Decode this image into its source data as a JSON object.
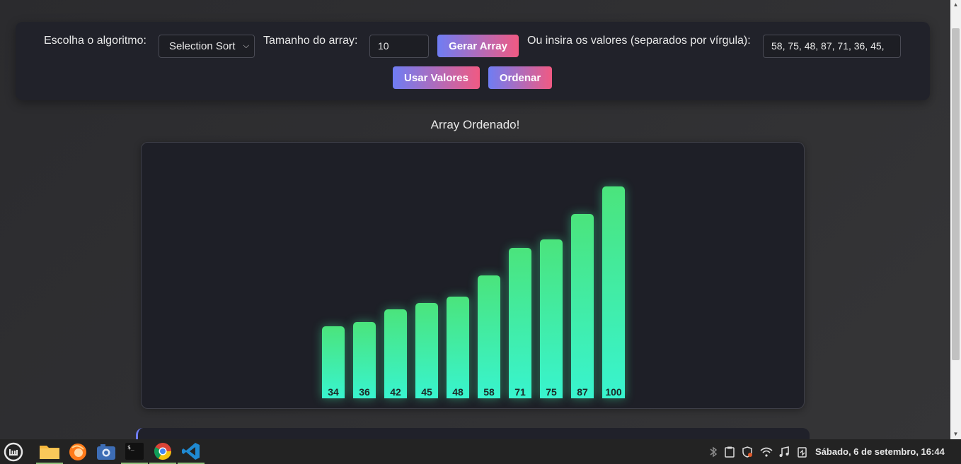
{
  "controls": {
    "algorithm_label": "Escolha o algoritmo:",
    "algorithm_selected": "Selection Sort",
    "size_label": "Tamanho do array:",
    "size_value": "10",
    "generate_button": "Gerar Array",
    "values_label": "Ou insira os valores (separados por vírgula):",
    "values_input": "58, 75, 48, 87, 71, 36, 45,",
    "use_values_button": "Usar Valores",
    "sort_button": "Ordenar"
  },
  "status": "Array Ordenado!",
  "chart_data": {
    "type": "bar",
    "categories": [
      "34",
      "36",
      "42",
      "45",
      "48",
      "58",
      "71",
      "75",
      "87",
      "100"
    ],
    "values": [
      34,
      36,
      42,
      45,
      48,
      58,
      71,
      75,
      87,
      100
    ],
    "ylim": [
      0,
      100
    ],
    "colors": {
      "bar_top": "#4be47c",
      "bar_bottom": "#38f4cf"
    }
  },
  "taskbar": {
    "apps": [
      {
        "name": "linux-mint-menu-icon"
      },
      {
        "name": "files-folder-icon"
      },
      {
        "name": "firefox-icon"
      },
      {
        "name": "screenshot-camera-icon"
      },
      {
        "name": "terminal-icon"
      },
      {
        "name": "chrome-icon"
      },
      {
        "name": "vscode-icon"
      }
    ],
    "clock": "Sábado,  6 de setembro, 16:44"
  },
  "colors": {
    "accent_start": "#6f7df3",
    "accent_end": "#f05a83",
    "panel_bg": "#21222a",
    "chart_bg": "#1e1f27"
  }
}
